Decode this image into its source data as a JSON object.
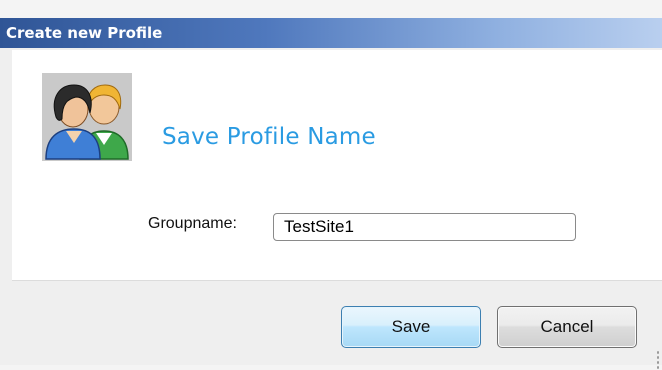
{
  "window": {
    "title": "Create new Profile"
  },
  "header": {
    "heading": "Save Profile Name",
    "icon": "users-icon"
  },
  "form": {
    "groupname_label": "Groupname:",
    "groupname_value": "TestSite1"
  },
  "buttons": {
    "save_label": "Save",
    "cancel_label": "Cancel"
  },
  "colors": {
    "heading": "#2a9be2",
    "titlebar_start": "#2f5596",
    "titlebar_end": "#b9cfef"
  }
}
